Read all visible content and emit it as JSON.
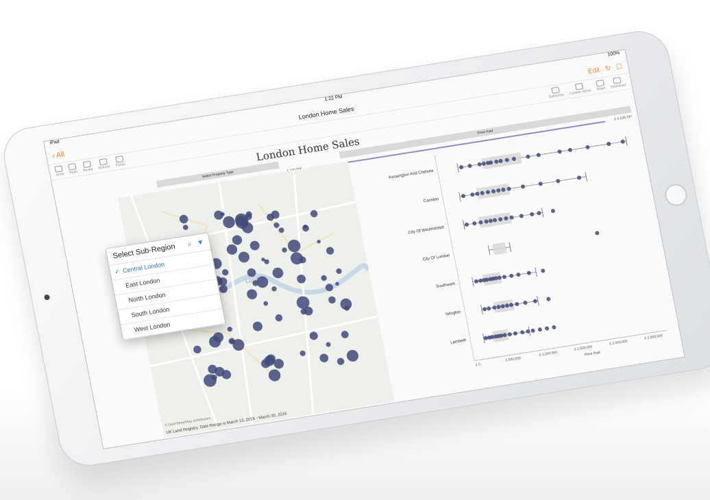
{
  "status": {
    "carrier": "iPad",
    "time": "1:22 PM",
    "battery": "100%"
  },
  "nav": {
    "back_label": "All",
    "title": "London Home Sales",
    "edit_label": "Edit"
  },
  "toolbar": {
    "left": [
      "Undo",
      "Redo",
      "Revert",
      "Refresh",
      "Pause"
    ],
    "right": [
      "Subscribe",
      "Custom Views",
      "Share",
      "Download"
    ]
  },
  "viz": {
    "title": "London Home Sales",
    "property_type_header": "Select Property Type",
    "price_header": "Price Paid",
    "slider_min": "£ 130,506",
    "slider_max": "£ 4,108,797",
    "map_credit": "© OpenStreetMap contributors",
    "map_caption": "UK Land Registry. Date Range is March 13, 2015 - March 30, 2015",
    "map_place_label": "London"
  },
  "popover": {
    "title": "Select Sub-Region",
    "items": [
      {
        "label": "Central London",
        "selected": true
      },
      {
        "label": "East London",
        "selected": false
      },
      {
        "label": "North London",
        "selected": false
      },
      {
        "label": "South London",
        "selected": false
      },
      {
        "label": "West London",
        "selected": false
      }
    ]
  },
  "colors": {
    "accent": "#f08b2c",
    "marker": "#3f4a7a",
    "select": "#2f6fcb"
  },
  "chart_data": {
    "type": "scatter",
    "xlabel": "Price Paid",
    "x_ticks": [
      "£ 0",
      "£ 500,000",
      "£ 1,000,000",
      "£ 1,500,000",
      "£ 2,000,000",
      "£ 2,500,000"
    ],
    "xlim": [
      0,
      2700000
    ],
    "categories": [
      "Kensington And Chelsea",
      "Camden",
      "City Of Westminster",
      "City Of London",
      "Southwark",
      "Islington",
      "Lambeth"
    ],
    "series": [
      {
        "name": "Kensington And Chelsea",
        "box": [
          600000,
          1150000
        ],
        "whiskers": [
          250000,
          2650000
        ],
        "values": [
          300000,
          420000,
          560000,
          620000,
          680000,
          720000,
          800000,
          860000,
          950000,
          1050000,
          1250000,
          1400000,
          1700000,
          1850000,
          2100000,
          2400000,
          2600000
        ]
      },
      {
        "name": "Camden",
        "box": [
          450000,
          900000
        ],
        "whiskers": [
          200000,
          2000000
        ],
        "values": [
          250000,
          380000,
          450000,
          520000,
          600000,
          680000,
          750000,
          820000,
          900000,
          1100000,
          1350000,
          1600000,
          1900000
        ]
      },
      {
        "name": "City Of Westminster",
        "box": [
          400000,
          850000
        ],
        "whiskers": [
          180000,
          1300000
        ],
        "values": [
          220000,
          330000,
          420000,
          500000,
          560000,
          620000,
          700000,
          780000,
          860000,
          1000000,
          1150000,
          1250000,
          1450000
        ]
      },
      {
        "name": "City Of London",
        "box": [
          520000,
          700000
        ],
        "whiskers": [
          460000,
          760000
        ],
        "values": [
          2000000
        ]
      },
      {
        "name": "Southwark",
        "box": [
          300000,
          550000
        ],
        "whiskers": [
          150000,
          1050000
        ],
        "values": [
          200000,
          260000,
          310000,
          350000,
          400000,
          440000,
          480000,
          530000,
          600000,
          700000,
          800000,
          950000,
          1150000
        ]
      },
      {
        "name": "Islington",
        "box": [
          380000,
          650000
        ],
        "whiskers": [
          200000,
          1000000
        ],
        "values": [
          240000,
          300000,
          380000,
          440000,
          500000,
          560000,
          620000,
          700000,
          820000,
          960000,
          1150000
        ]
      },
      {
        "name": "Lambeth",
        "box": [
          280000,
          500000
        ],
        "whiskers": [
          150000,
          800000
        ],
        "values": [
          180000,
          230000,
          270000,
          320000,
          360000,
          400000,
          450000,
          520000,
          600000,
          700000,
          780000,
          850000,
          950000,
          1050000,
          1150000
        ]
      }
    ]
  }
}
